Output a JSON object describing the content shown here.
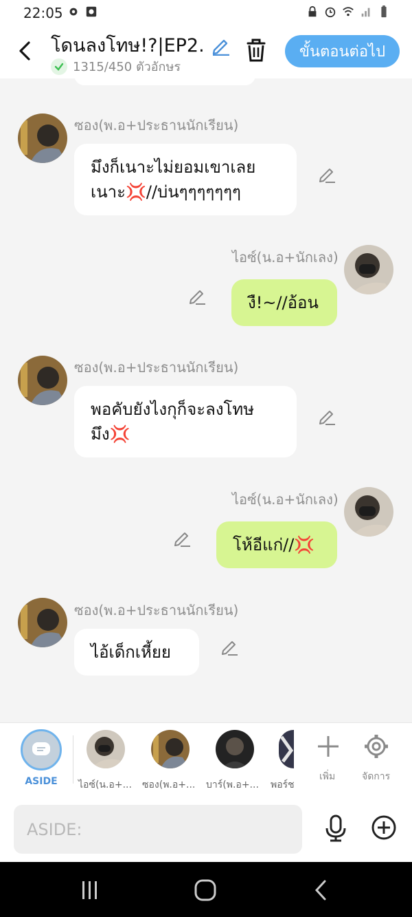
{
  "status_bar": {
    "time": "22:05"
  },
  "header": {
    "title": "โดนลงโทษ!?|EP2.",
    "char_count": "1315/450 ตัวอักษร",
    "next_button": "ขั้นตอนต่อไป"
  },
  "messages": [
    {
      "side": "left",
      "sender": "ซอง(พ.อ+ประธานนักเรียน)",
      "line1": "มึงก็เนาะไม่ยอมเขาเลย",
      "line2": "เนาะ💢//บ่นๆๆๆๆๆๆๆ"
    },
    {
      "side": "right",
      "sender": "ไอซ์(น.อ+นักเลง)",
      "line1": "งื!~//อ้อน"
    },
    {
      "side": "left",
      "sender": "ซอง(พ.อ+ประธานนักเรียน)",
      "line1": "พอคับยังไงกุก็จะลงโทษ",
      "line2": "มึง💢"
    },
    {
      "side": "right",
      "sender": "ไอซ์(น.อ+นักเลง)",
      "line1": "โห้อีแก่//💢"
    },
    {
      "side": "left",
      "sender": "ซอง(พ.อ+ประธานนักเรียน)",
      "line1": "ไอ้เด็กเหี้ยย"
    }
  ],
  "bottom_bar": {
    "aside_label": "ASIDE",
    "characters": [
      "ไอซ์(น.อ+...",
      "ซอง(พ.อ+...",
      "บาร์(พ.อ+...",
      "พอร์ช"
    ],
    "add_label": "เพิ่ม",
    "manage_label": "จัดการ"
  },
  "input": {
    "placeholder": "ASIDE:"
  },
  "colors": {
    "accent": "#5aaef2",
    "bubble_right": "#d7f592",
    "bubble_left": "#ffffff",
    "background": "#f4f4f4"
  }
}
